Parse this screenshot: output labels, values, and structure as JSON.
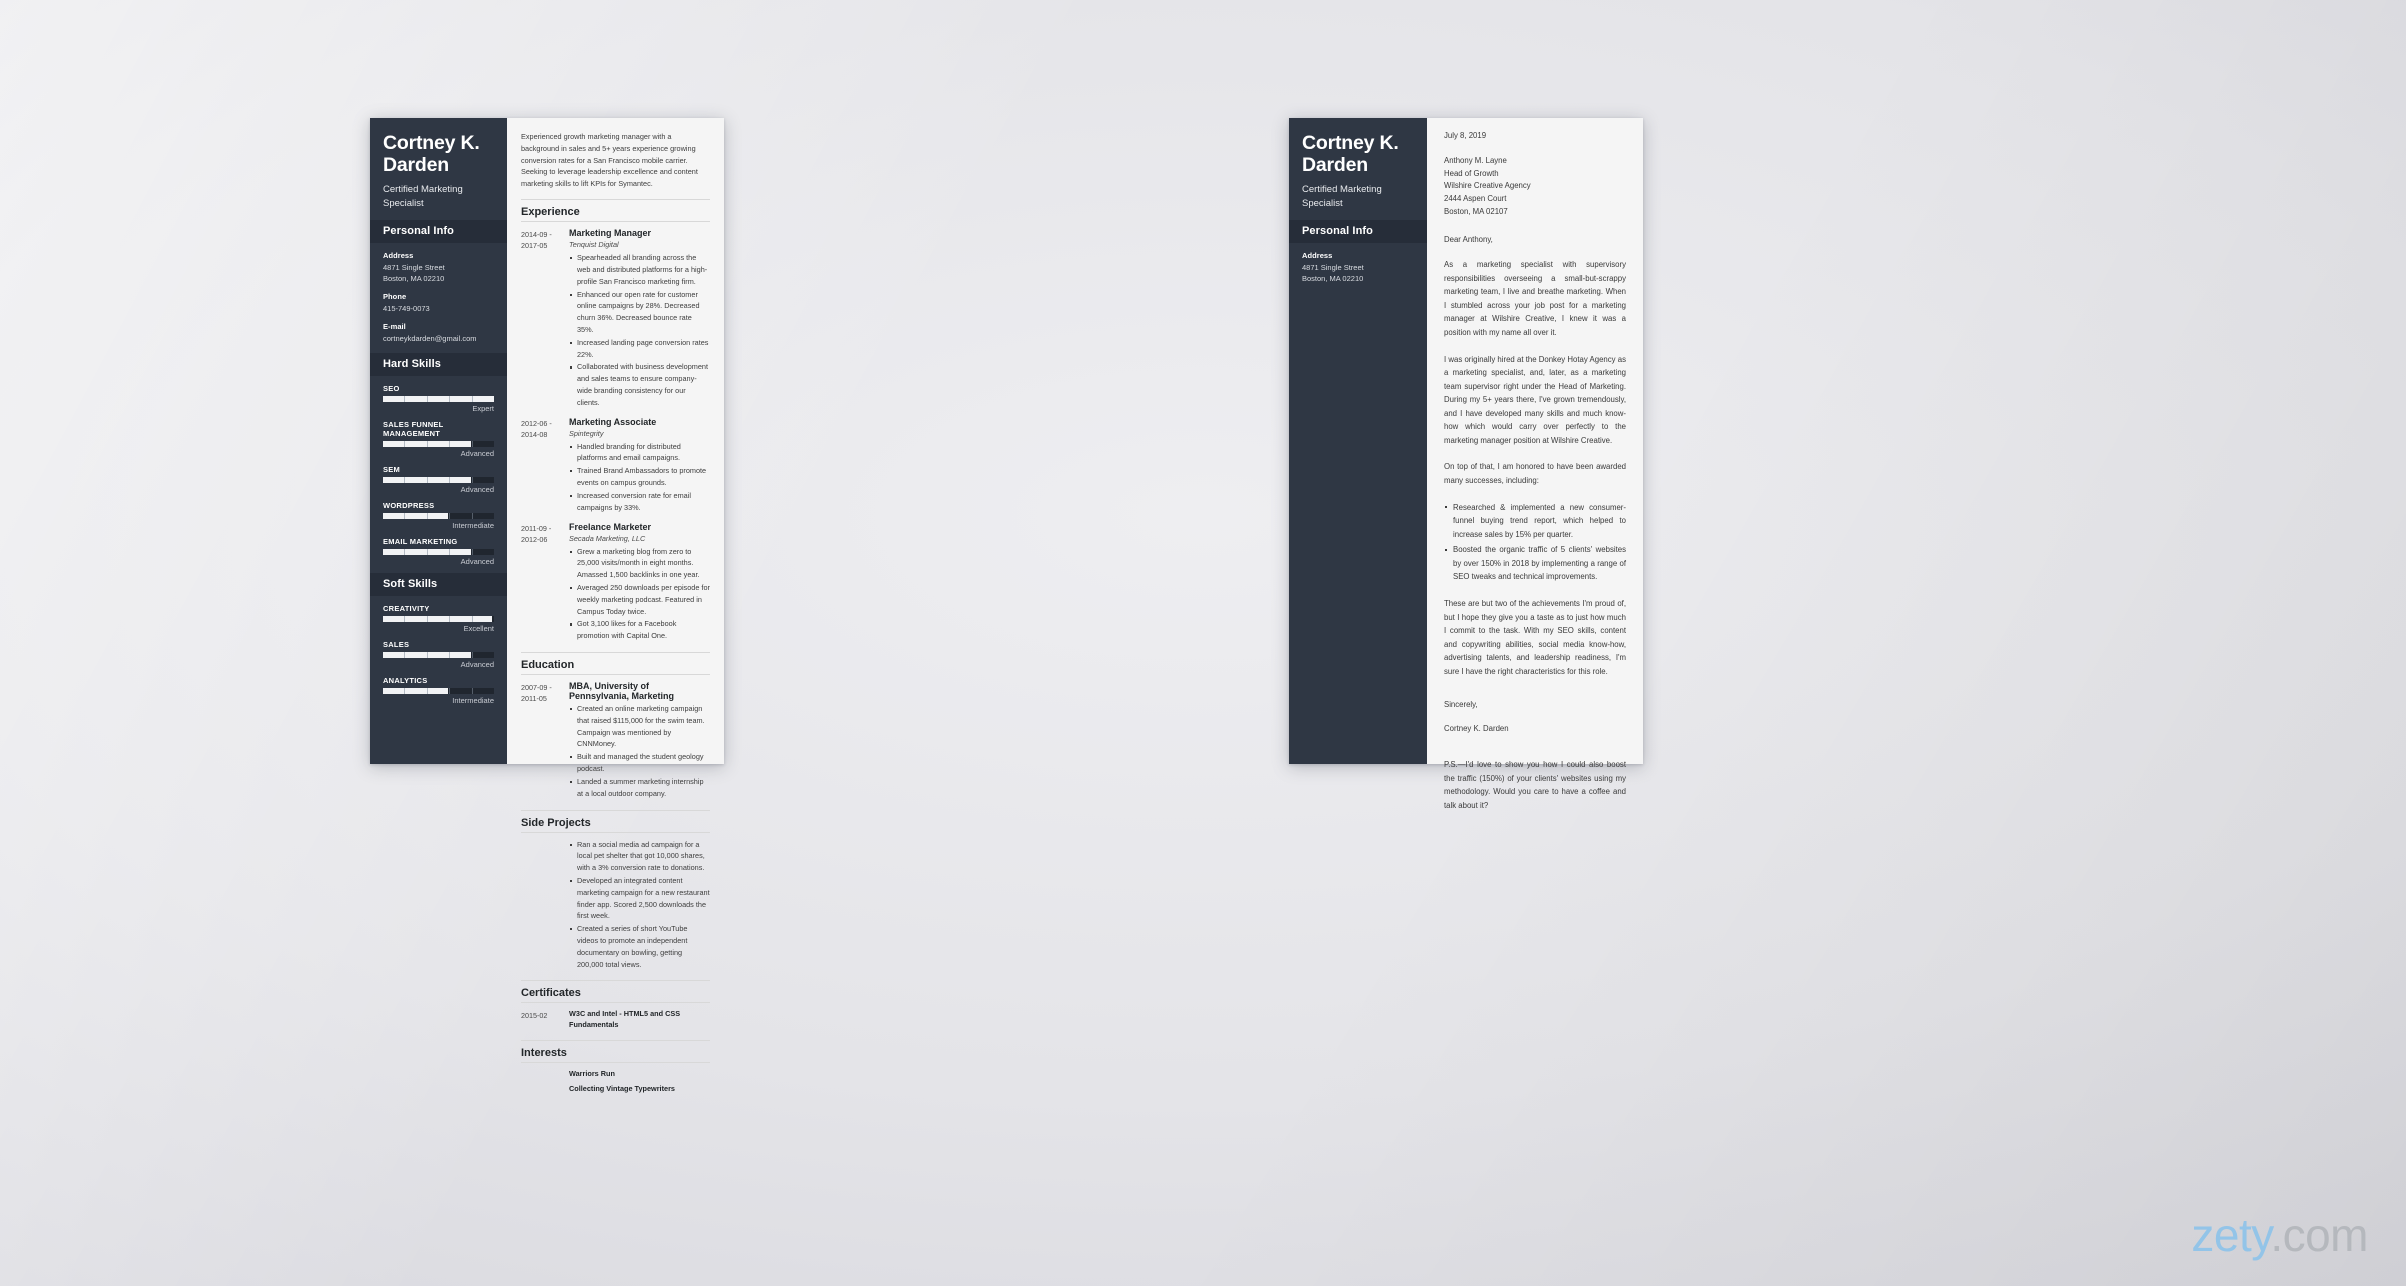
{
  "watermark": {
    "brand": "zety",
    "tld": ".com"
  },
  "resume": {
    "sidebar": {
      "name": "Cortney K. Darden",
      "role": "Certified Marketing Specialist",
      "personal_info_title": "Personal Info",
      "fields": [
        {
          "label": "Address",
          "value": "4871 Single Street\nBoston, MA 02210"
        },
        {
          "label": "Phone",
          "value": "415-749-0073"
        },
        {
          "label": "E-mail",
          "value": "cortneykdarden@gmail.com"
        }
      ],
      "hard_skills_title": "Hard Skills",
      "hard_skills": [
        {
          "name": "SEO",
          "level": "Expert",
          "percent": 100
        },
        {
          "name": "SALES FUNNEL MANAGEMENT",
          "level": "Advanced",
          "percent": 79
        },
        {
          "name": "SEM",
          "level": "Advanced",
          "percent": 79
        },
        {
          "name": "WORDPRESS",
          "level": "Intermediate",
          "percent": 59
        },
        {
          "name": "EMAIL MARKETING",
          "level": "Advanced",
          "percent": 79
        }
      ],
      "soft_skills_title": "Soft Skills",
      "soft_skills": [
        {
          "name": "CREATIVITY",
          "level": "Excellent",
          "percent": 98
        },
        {
          "name": "SALES",
          "level": "Advanced",
          "percent": 79
        },
        {
          "name": "ANALYTICS",
          "level": "Intermediate",
          "percent": 59
        }
      ]
    },
    "main": {
      "summary": "Experienced growth marketing manager with a background in sales and 5+ years experience growing conversion rates for a San Francisco mobile carrier. Seeking to leverage leadership excellence and content marketing skills to lift KPIs for Symantec.",
      "experience_title": "Experience",
      "experience": [
        {
          "dates": "2014-09 -\n2017-05",
          "title": "Marketing Manager",
          "company": "Tenquist Digital",
          "bullets": [
            "Spearheaded all branding across the web and distributed platforms for a high-profile San Francisco marketing firm.",
            "Enhanced our open rate for customer online campaigns by 28%. Decreased churn 36%. Decreased bounce rate 35%.",
            "Increased landing page conversion rates 22%.",
            "Collaborated with business development and sales teams to ensure company-wide branding consistency for our clients."
          ]
        },
        {
          "dates": "2012-06 -\n2014-08",
          "title": "Marketing Associate",
          "company": "Spintegrity",
          "bullets": [
            "Handled branding for distributed platforms and email campaigns.",
            "Trained Brand Ambassadors to promote events on campus grounds.",
            "Increased conversion rate for email campaigns by 33%."
          ]
        },
        {
          "dates": "2011-09 -\n2012-06",
          "title": "Freelance Marketer",
          "company": "Secada Marketing, LLC",
          "bullets": [
            "Grew a marketing blog from zero to 25,000 visits/month in eight months. Amassed 1,500 backlinks in one year.",
            "Averaged 250 downloads per episode for weekly marketing podcast. Featured in Campus Today twice.",
            "Got 3,100 likes for a Facebook promotion with Capital One."
          ]
        }
      ],
      "education_title": "Education",
      "education": [
        {
          "dates": "2007-09 -\n2011-05",
          "title": "MBA, University of Pennsylvania, Marketing",
          "bullets": [
            "Created an online marketing campaign that raised $115,000 for the swim team. Campaign was mentioned by CNNMoney.",
            "Built and managed the student geology podcast.",
            "Landed a summer marketing internship at a local outdoor company."
          ]
        }
      ],
      "side_projects_title": "Side Projects",
      "side_projects": [
        "Ran a social media ad campaign for a local pet shelter that got 10,000 shares, with a 3% conversion rate to donations.",
        "Developed an integrated content marketing campaign for a new restaurant finder app. Scored 2,500 downloads the first week.",
        "Created a series of short YouTube videos to promote an independent documentary on bowling, getting 200,000 total views."
      ],
      "certificates_title": "Certificates",
      "certificates": [
        {
          "date": "2015-02",
          "text": "W3C and Intel - HTML5 and CSS Fundamentals"
        }
      ],
      "interests_title": "Interests",
      "interests": [
        "Warriors Run",
        "Collecting Vintage Typewriters"
      ]
    }
  },
  "cover_letter": {
    "sidebar": {
      "name": "Cortney K. Darden",
      "role": "Certified Marketing Specialist",
      "personal_info_title": "Personal Info",
      "fields": [
        {
          "label": "Address",
          "value": "4871 Single Street\nBoston, MA 02210"
        }
      ]
    },
    "main": {
      "date": "July 8, 2019",
      "recipient": [
        "Anthony M. Layne",
        "Head of Growth",
        "Wilshire Creative Agency",
        "2444 Aspen Court",
        "Boston, MA 02107"
      ],
      "salutation": "Dear Anthony,",
      "paragraphs": [
        "As a marketing specialist with supervisory responsibilities overseeing a small-but-scrappy marketing team, I live and breathe marketing. When I stumbled across your job post for a marketing manager at Wilshire Creative, I knew it was a position with my name all over it.",
        "I was originally hired at the Donkey Hotay Agency as a marketing specialist, and, later, as a marketing team supervisor right under the Head of Marketing. During my 5+ years there, I've grown tremendously, and I have developed many skills and much know-how which would carry over perfectly to the marketing manager position at Wilshire Creative.",
        "On top of that, I am honored to have been awarded many successes, including:"
      ],
      "achievements": [
        "Researched & implemented a new consumer-funnel buying trend report, which helped to increase sales by 15% per quarter.",
        "Boosted the organic traffic of 5 clients' websites by over 150% in 2018 by implementing a range of SEO tweaks and technical improvements."
      ],
      "closing_paragraph": "These are but two of the achievements I'm proud of, but I hope they give you a taste as to just how much I commit to the task. With my SEO skills, content and copywriting abilities, social media know-how, advertising talents, and leadership readiness, I'm sure I have the right characteristics for this role.",
      "signoff": "Sincerely,",
      "signature": "Cortney K. Darden",
      "postscript": "P.S.—I'd love to show you how I could also boost the traffic (150%) of your clients' websites using my methodology. Would you care to have a coffee and talk about it?"
    }
  }
}
